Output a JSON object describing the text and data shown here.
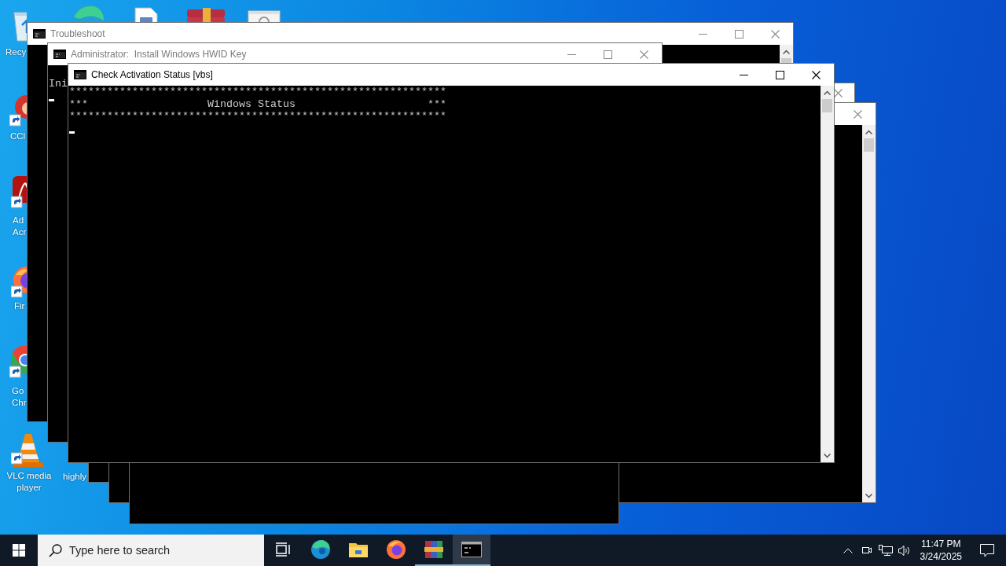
{
  "desktop_icons": [
    {
      "kind": "recycle-bin",
      "label_lines": [
        "Recy"
      ]
    },
    {
      "kind": "ccleaner",
      "label_lines": [
        "CCl"
      ]
    },
    {
      "kind": "acrobat",
      "label_lines": [
        "Ad",
        "Acr"
      ]
    },
    {
      "kind": "firefox",
      "label_lines": [
        "Fir"
      ]
    },
    {
      "kind": "chrome",
      "label_lines": [
        "Go",
        "Chr"
      ]
    },
    {
      "kind": "vlc",
      "label_lines": [
        "VLC media",
        "player"
      ]
    },
    {
      "kind": "hidden",
      "label_lines": [
        "highly"
      ]
    },
    {
      "kind": "edge"
    },
    {
      "kind": "document"
    },
    {
      "kind": "winrar"
    },
    {
      "kind": "settings-window"
    }
  ],
  "windows": [
    {
      "kind": "console",
      "active": false
    },
    {
      "kind": "console",
      "active": false
    },
    {
      "kind": "console"
    },
    {
      "kind": "console",
      "title": "Troubleshoot",
      "active": false
    },
    {
      "kind": "console",
      "title": "Administrator:  Install Windows HWID Key",
      "active": false,
      "lines": [
        "Ini"
      ]
    },
    {
      "kind": "console",
      "title": "Check Activation Status [vbs]",
      "active": true,
      "lines": [
        "************************************************************",
        "***                   Windows Status                     ***",
        "************************************************************"
      ]
    }
  ],
  "taskbar": {
    "search": {
      "placeholder": "Type here to search"
    },
    "apps": [
      {
        "kind": "task-view",
        "selected": false,
        "running": false
      },
      {
        "kind": "edge",
        "selected": false,
        "running": false
      },
      {
        "kind": "explorer",
        "selected": false,
        "running": false
      },
      {
        "kind": "firefox",
        "selected": false,
        "running": false
      },
      {
        "kind": "winrar",
        "selected": false,
        "running": true
      },
      {
        "kind": "terminal",
        "selected": true,
        "running": true
      }
    ],
    "tray": {
      "time": "11:47 PM",
      "date": "3/24/2025"
    }
  }
}
